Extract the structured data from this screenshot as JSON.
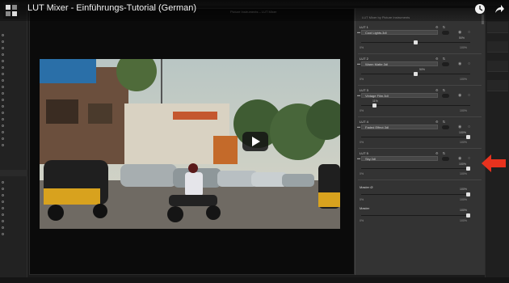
{
  "video": {
    "title": "LUT Mixer - Einführungs-Tutorial (German)",
    "channel_icon": "channel-logo-icon",
    "watch_later_icon": "clock-icon",
    "share_icon": "share-arrow-icon",
    "play_icon": "play-icon"
  },
  "monitor": {
    "label": "Picture Instruments – LUT Mixer",
    "scene": "street-scene-with-auto-rickshaws"
  },
  "plugin": {
    "title": "LUT Mixer by Picture Instruments",
    "luts": [
      {
        "label": "LUT 1",
        "file": "Cool Lights.3dl",
        "value": "50%",
        "position": 0.5
      },
      {
        "label": "LUT 2",
        "file": "Warm Matte.3dl",
        "value": "50%",
        "position": 0.5
      },
      {
        "label": "LUT 3",
        "file": "Vintage Film.3dl",
        "value": "11%",
        "position": 0.11
      },
      {
        "label": "LUT 4",
        "file": "Faded Effect.3dl",
        "value": "100%",
        "position": 1.0
      },
      {
        "label": "LUT 5",
        "file": "Sky.3dl",
        "value": "100%",
        "position": 1.0
      }
    ],
    "range_min": "0%",
    "range_max": "100%",
    "master_o": {
      "label": "Master Ø",
      "value": "100%",
      "position": 1.0
    },
    "master": {
      "label": "Master",
      "value": "100%",
      "position": 1.0
    }
  },
  "annotation": {
    "color": "#e8321e"
  },
  "colors": {
    "accent": "#3b8fd9",
    "panel": "#333333",
    "background": "#1b1b1b"
  }
}
